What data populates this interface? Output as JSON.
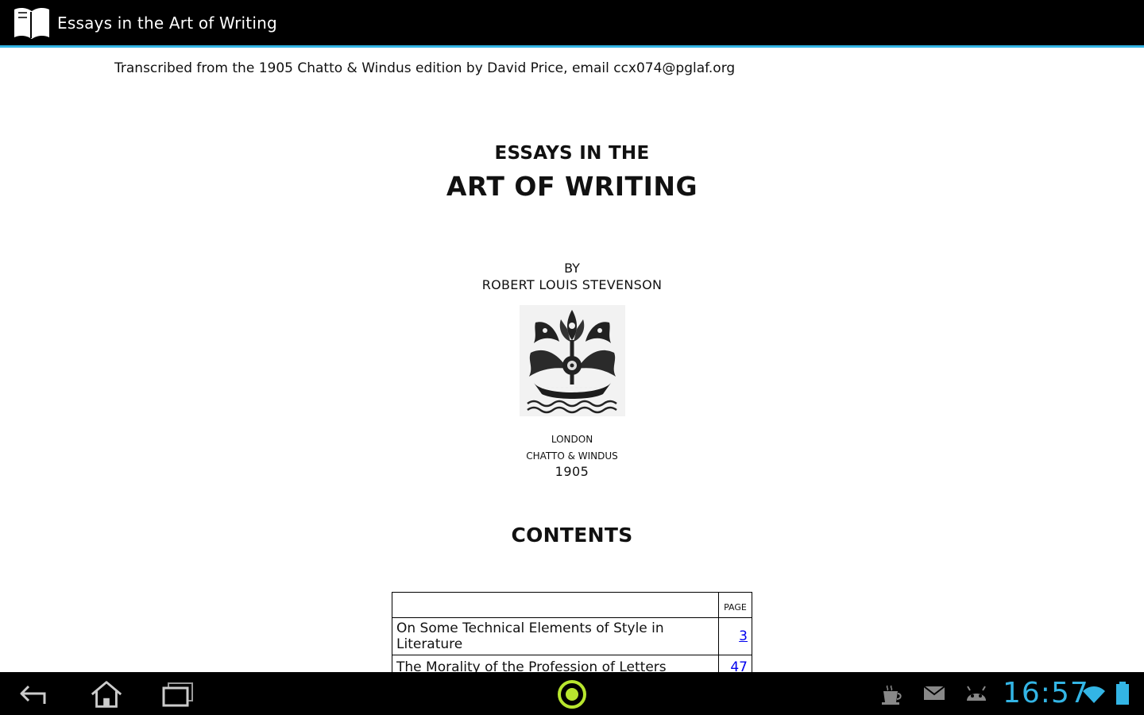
{
  "app": {
    "title": "Essays in the Art of Writing",
    "icon": "open-book-icon"
  },
  "book": {
    "transcribed_note": "Transcribed from the 1905 Chatto & Windus edition by David Price, email ccx074@pglaf.org",
    "title_line1": "ESSAYS IN THE",
    "title_line2": "ART OF WRITING",
    "by": "BY",
    "author": "ROBERT LOUIS STEVENSON",
    "emblem": "publisher-emblem-image",
    "place": "LONDON",
    "publisher": "CHATTO & WINDUS",
    "year": "1905",
    "contents_heading": "CONTENTS",
    "toc": {
      "page_header": "PAGE",
      "rows": [
        {
          "title": "On Some Technical Elements of Style in Literature",
          "page": "3"
        },
        {
          "title": "The Morality of the Profession of Letters",
          "page": "47"
        }
      ]
    }
  },
  "system": {
    "clock": "16:57",
    "nav": [
      "back-icon",
      "home-icon",
      "recent-apps-icon"
    ],
    "center": "reader-app-icon",
    "status": [
      "teacup-notification-icon",
      "mail-icon",
      "android-debug-icon",
      "wifi-icon",
      "battery-icon"
    ],
    "accent": "#33b5e5"
  }
}
